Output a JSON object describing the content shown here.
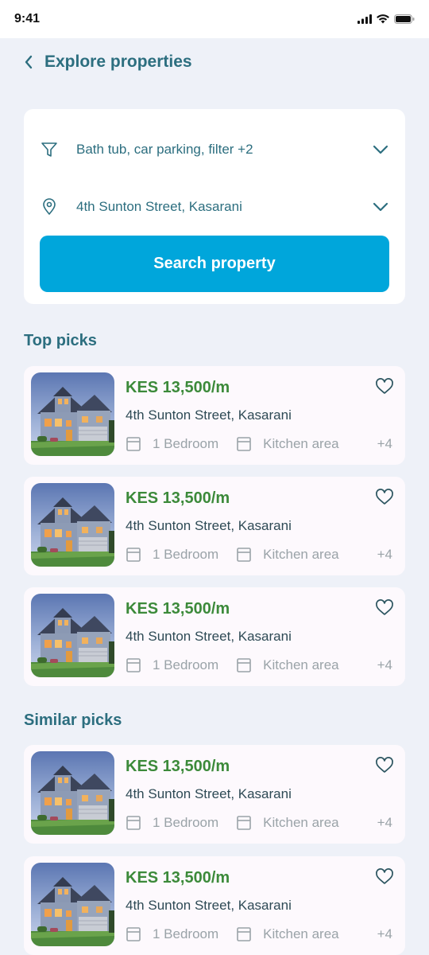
{
  "status_bar": {
    "time": "9:41",
    "icons": [
      "signal-icon",
      "wifi-icon",
      "battery-icon"
    ]
  },
  "header": {
    "title": "Explore properties",
    "back_icon": "chevron-left-icon"
  },
  "search": {
    "filter_value": "Bath tub, car parking, filter +2",
    "location_value": "4th Sunton Street, Kasarani",
    "button_label": "Search property"
  },
  "sections": {
    "top_picks": "Top picks",
    "similar_picks": "Similar picks"
  },
  "top_picks": [
    {
      "price": "KES 13,500/m",
      "address": "4th Sunton Street, Kasarani",
      "amenity1": "1 Bedroom",
      "amenity2": "Kitchen area",
      "more": "+4"
    },
    {
      "price": "KES 13,500/m",
      "address": "4th Sunton Street, Kasarani",
      "amenity1": "1 Bedroom",
      "amenity2": "Kitchen area",
      "more": "+4"
    },
    {
      "price": "KES 13,500/m",
      "address": "4th Sunton Street, Kasarani",
      "amenity1": "1 Bedroom",
      "amenity2": "Kitchen area",
      "more": "+4"
    }
  ],
  "similar_picks": [
    {
      "price": "KES 13,500/m",
      "address": "4th Sunton Street, Kasarani",
      "amenity1": "1 Bedroom",
      "amenity2": "Kitchen area",
      "more": "+4"
    },
    {
      "price": "KES 13,500/m",
      "address": "4th Sunton Street, Kasarani",
      "amenity1": "1 Bedroom",
      "amenity2": "Kitchen area",
      "more": "+4"
    }
  ],
  "colors": {
    "accent": "#00a6db",
    "title": "#2c6e7f",
    "price": "#3c8a3a",
    "background": "#eef1f8"
  }
}
